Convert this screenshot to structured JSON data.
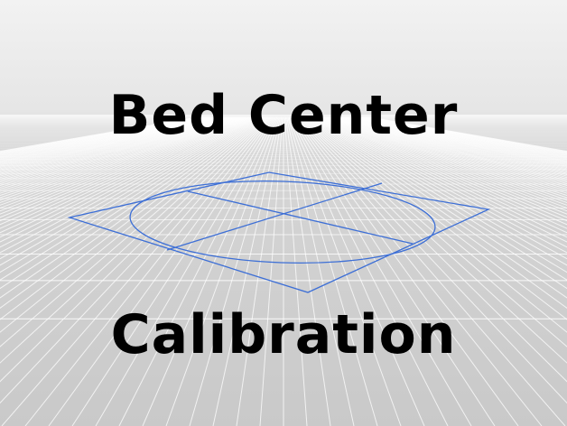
{
  "scene": {
    "title_line1": "Bed Center",
    "title_line2": "Calibration",
    "colors": {
      "background_top": "#f2f2f2",
      "background_bottom": "#c9c9c9",
      "grid_line": "#ffffff",
      "model_line": "#3d6fd6",
      "text": "#000000"
    }
  }
}
